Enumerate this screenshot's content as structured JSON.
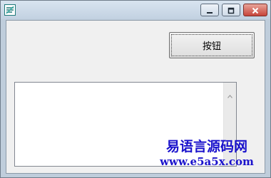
{
  "window": {
    "icon": "app-logo-icon",
    "controls": {
      "minimize_icon": "minimize-icon",
      "maximize_icon": "maximize-icon",
      "close_icon": "close-icon"
    }
  },
  "main": {
    "button_label": "按钮",
    "edit_value": ""
  },
  "watermark": {
    "title": "易语言源码网",
    "url": "www.e5a5x.com"
  },
  "colors": {
    "watermark": "#1a12cc",
    "close_button": "#c7443a",
    "titlebar": "#c2d1e1"
  }
}
